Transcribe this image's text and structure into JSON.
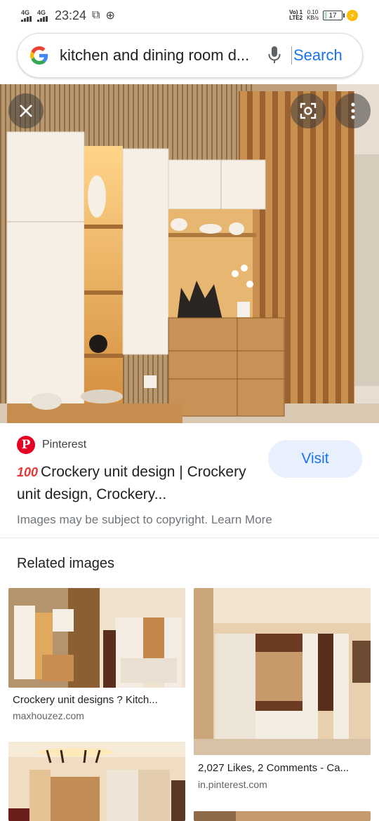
{
  "status_bar": {
    "signal1": "4G",
    "signal2": "4G",
    "time": "23:24",
    "volte_top": "Vo) 1",
    "volte_bottom": "LTE2",
    "speed_top": "0.10",
    "speed_bottom": "KB/s",
    "battery": "17"
  },
  "search": {
    "query": "kitchen and dining room d...",
    "search_label": "Search"
  },
  "result": {
    "source_name": "Pinterest",
    "emoji": "100",
    "title": "Crockery unit design | Crockery unit design, Crockery...",
    "visit_label": "Visit",
    "copyright": "Images may be subject to copyright. Learn More"
  },
  "related": {
    "heading": "Related images",
    "items": [
      {
        "caption": "Crockery unit designs ? Kitch...",
        "domain": "maxhouzez.com"
      },
      {
        "caption": "2,027 Likes, 2 Comments - Ca...",
        "domain": "in.pinterest.com"
      }
    ]
  },
  "colors": {
    "accent": "#1a73e8",
    "visit_bg": "#e8f0fe",
    "pinterest": "#e60023"
  }
}
